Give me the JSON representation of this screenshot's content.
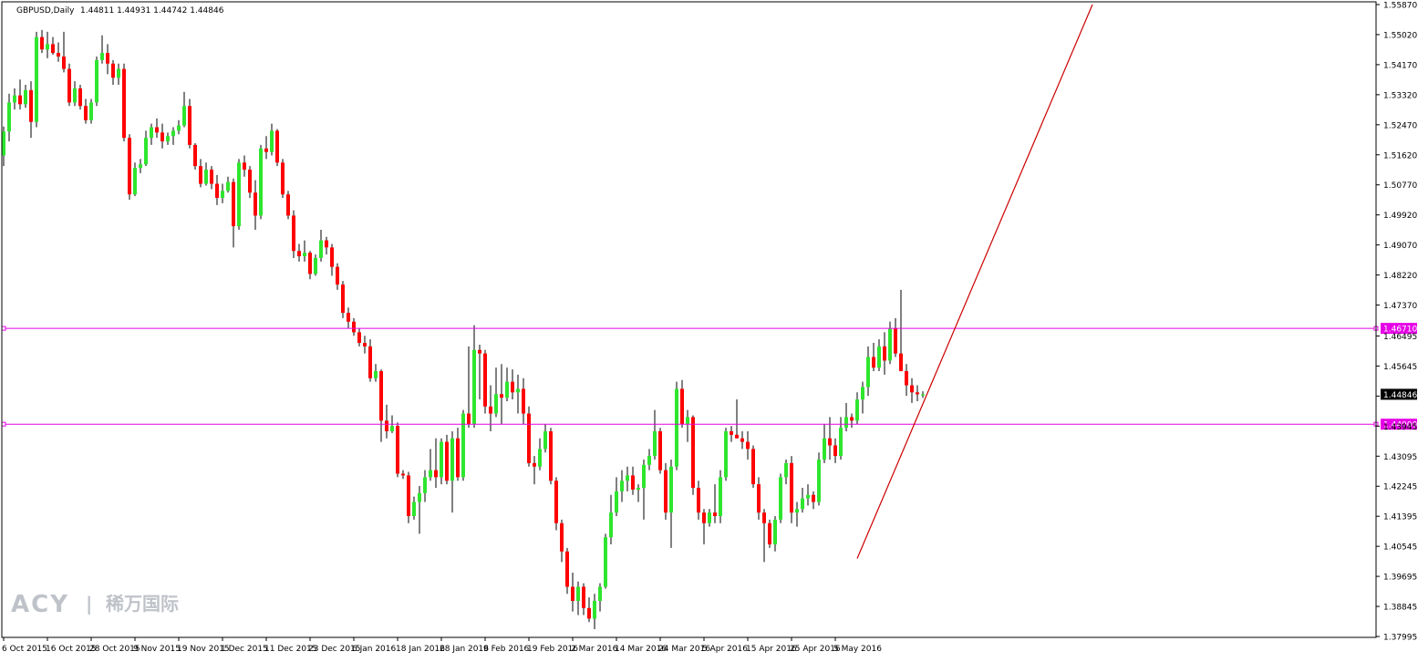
{
  "header": {
    "symbol": "GBPUSD,Daily",
    "ohlc": "1.44811 1.44931 1.44742 1.44846"
  },
  "colors": {
    "bull": "#2ee62e",
    "bear": "#ff0000",
    "wick": "#000000",
    "hline": "#e600e6",
    "trendline": "#cc0000",
    "price_label_bg": "#000000"
  },
  "watermark": {
    "brand": "ACY",
    "separator": "|",
    "cn": "稀万国际"
  },
  "chart_data": {
    "type": "candlestick",
    "title": "GBPUSD,Daily",
    "ylim": [
      1.37995,
      1.5587
    ],
    "y_ticks": [
      "1.55870",
      "1.55020",
      "1.54170",
      "1.53320",
      "1.52470",
      "1.51620",
      "1.50770",
      "1.49920",
      "1.49070",
      "1.48220",
      "1.47370",
      "1.46495",
      "1.45645",
      "1.44795",
      "1.43945",
      "1.43095",
      "1.42245",
      "1.41395",
      "1.40545",
      "1.39695",
      "1.38845",
      "1.37995"
    ],
    "x_labels": [
      "6 Oct 2015",
      "16 Oct 2015",
      "28 Oct 2015",
      "9 Nov 2015",
      "19 Nov 2015",
      "1 Dec 2015",
      "11 Dec 2015",
      "23 Dec 2015",
      "6 Jan 2016",
      "18 Jan 2016",
      "28 Jan 2016",
      "9 Feb 2016",
      "19 Feb 2016",
      "2 Mar 2016",
      "14 Mar 2016",
      "24 Mar 2016",
      "5 Apr 2016",
      "15 Apr 2016",
      "25 Apr 2016",
      "5 May 2016"
    ],
    "horizontal_lines": [
      {
        "price": 1.4671,
        "label": "1.46710"
      },
      {
        "price": 1.44,
        "label": "1.44000"
      }
    ],
    "current_price": {
      "price": 1.44846,
      "label": "1.44846"
    },
    "trendline": {
      "from": [
        156,
        1.402
      ],
      "to": [
        199,
        1.5587
      ]
    },
    "candles": [
      [
        1.516,
        1.5242,
        1.513,
        1.5228
      ],
      [
        1.5228,
        1.5335,
        1.52,
        1.531
      ],
      [
        1.531,
        1.535,
        1.529,
        1.533
      ],
      [
        1.533,
        1.5375,
        1.529,
        1.5305
      ],
      [
        1.5305,
        1.536,
        1.5295,
        1.5345
      ],
      [
        1.5345,
        1.537,
        1.521,
        1.5255
      ],
      [
        1.5255,
        1.551,
        1.524,
        1.5495
      ],
      [
        1.5495,
        1.5515,
        1.545,
        1.546
      ],
      [
        1.546,
        1.551,
        1.5435,
        1.5475
      ],
      [
        1.5475,
        1.5495,
        1.5445,
        1.545
      ],
      [
        1.545,
        1.548,
        1.5425,
        1.544
      ],
      [
        1.544,
        1.551,
        1.5395,
        1.5405
      ],
      [
        1.5405,
        1.542,
        1.53,
        1.531
      ],
      [
        1.531,
        1.537,
        1.53,
        1.535
      ],
      [
        1.535,
        1.536,
        1.529,
        1.53
      ],
      [
        1.53,
        1.532,
        1.525,
        1.526
      ],
      [
        1.526,
        1.532,
        1.525,
        1.531
      ],
      [
        1.531,
        1.544,
        1.53,
        1.543
      ],
      [
        1.543,
        1.55,
        1.542,
        1.545
      ],
      [
        1.545,
        1.5475,
        1.539,
        1.542
      ],
      [
        1.542,
        1.543,
        1.536,
        1.538
      ],
      [
        1.538,
        1.542,
        1.536,
        1.5405
      ],
      [
        1.5405,
        1.542,
        1.52,
        1.521
      ],
      [
        1.521,
        1.522,
        1.5035,
        1.505
      ],
      [
        1.505,
        1.514,
        1.5045,
        1.5125
      ],
      [
        1.5125,
        1.515,
        1.511,
        1.5135
      ],
      [
        1.5135,
        1.523,
        1.513,
        1.521
      ],
      [
        1.521,
        1.525,
        1.519,
        1.524
      ],
      [
        1.524,
        1.5265,
        1.521,
        1.5225
      ],
      [
        1.5225,
        1.525,
        1.518,
        1.52
      ],
      [
        1.52,
        1.5225,
        1.519,
        1.5215
      ],
      [
        1.5215,
        1.524,
        1.519,
        1.523
      ],
      [
        1.523,
        1.526,
        1.522,
        1.5245
      ],
      [
        1.5245,
        1.534,
        1.524,
        1.53
      ],
      [
        1.53,
        1.532,
        1.518,
        1.519
      ],
      [
        1.519,
        1.5195,
        1.512,
        1.513
      ],
      [
        1.513,
        1.515,
        1.507,
        1.508
      ],
      [
        1.508,
        1.514,
        1.5075,
        1.512
      ],
      [
        1.512,
        1.513,
        1.5065,
        1.508
      ],
      [
        1.508,
        1.5105,
        1.502,
        1.504
      ],
      [
        1.504,
        1.508,
        1.5025,
        1.506
      ],
      [
        1.506,
        1.51,
        1.5055,
        1.5085
      ],
      [
        1.5085,
        1.5095,
        1.49,
        1.496
      ],
      [
        1.496,
        1.515,
        1.495,
        1.514
      ],
      [
        1.514,
        1.516,
        1.51,
        1.512
      ],
      [
        1.512,
        1.513,
        1.504,
        1.5055
      ],
      [
        1.5055,
        1.509,
        1.495,
        1.499
      ],
      [
        1.499,
        1.519,
        1.498,
        1.518
      ],
      [
        1.518,
        1.5215,
        1.515,
        1.517
      ],
      [
        1.517,
        1.525,
        1.516,
        1.523
      ],
      [
        1.523,
        1.5235,
        1.513,
        1.514
      ],
      [
        1.514,
        1.515,
        1.504,
        1.505
      ],
      [
        1.505,
        1.506,
        1.498,
        1.499
      ],
      [
        1.499,
        1.5005,
        1.487,
        1.489
      ],
      [
        1.489,
        1.491,
        1.486,
        1.4875
      ],
      [
        1.4875,
        1.492,
        1.486,
        1.4885
      ],
      [
        1.4885,
        1.489,
        1.481,
        1.4825
      ],
      [
        1.4825,
        1.488,
        1.482,
        1.487
      ],
      [
        1.487,
        1.495,
        1.486,
        1.492
      ],
      [
        1.492,
        1.493,
        1.488,
        1.49
      ],
      [
        1.49,
        1.491,
        1.482,
        1.4845
      ],
      [
        1.4845,
        1.4855,
        1.478,
        1.4795
      ],
      [
        1.4795,
        1.4805,
        1.47,
        1.4715
      ],
      [
        1.4715,
        1.473,
        1.467,
        1.469
      ],
      [
        1.469,
        1.47,
        1.465,
        1.466
      ],
      [
        1.466,
        1.467,
        1.462,
        1.463
      ],
      [
        1.463,
        1.465,
        1.46,
        1.462
      ],
      [
        1.462,
        1.464,
        1.452,
        1.453
      ],
      [
        1.453,
        1.457,
        1.452,
        1.455
      ],
      [
        1.455,
        1.4555,
        1.435,
        1.441
      ],
      [
        1.441,
        1.4455,
        1.436,
        1.438
      ],
      [
        1.438,
        1.4425,
        1.4375,
        1.4395
      ],
      [
        1.4395,
        1.4405,
        1.425,
        1.426
      ],
      [
        1.426,
        1.427,
        1.4245,
        1.4255
      ],
      [
        1.4255,
        1.4265,
        1.412,
        1.414
      ],
      [
        1.414,
        1.4195,
        1.413,
        1.418
      ],
      [
        1.418,
        1.4225,
        1.409,
        1.4205
      ],
      [
        1.4205,
        1.427,
        1.418,
        1.425
      ],
      [
        1.425,
        1.433,
        1.424,
        1.427
      ],
      [
        1.427,
        1.436,
        1.422,
        1.425
      ],
      [
        1.425,
        1.436,
        1.423,
        1.435
      ],
      [
        1.435,
        1.437,
        1.423,
        1.424
      ],
      [
        1.424,
        1.438,
        1.415,
        1.436
      ],
      [
        1.436,
        1.439,
        1.424,
        1.425
      ],
      [
        1.425,
        1.444,
        1.424,
        1.443
      ],
      [
        1.443,
        1.462,
        1.439,
        1.44
      ],
      [
        1.44,
        1.468,
        1.439,
        1.461
      ],
      [
        1.461,
        1.4625,
        1.447,
        1.46
      ],
      [
        1.46,
        1.461,
        1.443,
        1.445
      ],
      [
        1.445,
        1.451,
        1.438,
        1.443
      ],
      [
        1.443,
        1.456,
        1.442,
        1.4485
      ],
      [
        1.4485,
        1.457,
        1.44,
        1.4475
      ],
      [
        1.4475,
        1.456,
        1.4465,
        1.452
      ],
      [
        1.452,
        1.4555,
        1.447,
        1.449
      ],
      [
        1.449,
        1.454,
        1.443,
        1.45
      ],
      [
        1.45,
        1.453,
        1.44,
        1.443
      ],
      [
        1.443,
        1.445,
        1.428,
        1.429
      ],
      [
        1.429,
        1.431,
        1.423,
        1.428
      ],
      [
        1.428,
        1.436,
        1.427,
        1.433
      ],
      [
        1.433,
        1.44,
        1.432,
        1.438
      ],
      [
        1.438,
        1.439,
        1.423,
        1.424
      ],
      [
        1.424,
        1.425,
        1.41,
        1.412
      ],
      [
        1.412,
        1.413,
        1.401,
        1.404
      ],
      [
        1.404,
        1.405,
        1.392,
        1.394
      ],
      [
        1.394,
        1.398,
        1.387,
        1.39
      ],
      [
        1.39,
        1.3955,
        1.386,
        1.394
      ],
      [
        1.394,
        1.395,
        1.386,
        1.388
      ],
      [
        1.388,
        1.391,
        1.384,
        1.385
      ],
      [
        1.385,
        1.392,
        1.382,
        1.39
      ],
      [
        1.39,
        1.395,
        1.387,
        1.394
      ],
      [
        1.394,
        1.409,
        1.3935,
        1.408
      ],
      [
        1.408,
        1.42,
        1.406,
        1.415
      ],
      [
        1.415,
        1.425,
        1.414,
        1.421
      ],
      [
        1.421,
        1.427,
        1.418,
        1.424
      ],
      [
        1.424,
        1.428,
        1.421,
        1.4255
      ],
      [
        1.4255,
        1.428,
        1.42,
        1.4215
      ],
      [
        1.4215,
        1.423,
        1.418,
        1.422
      ],
      [
        1.422,
        1.43,
        1.413,
        1.4285
      ],
      [
        1.4285,
        1.433,
        1.427,
        1.431
      ],
      [
        1.431,
        1.444,
        1.43,
        1.438
      ],
      [
        1.438,
        1.439,
        1.426,
        1.427
      ],
      [
        1.427,
        1.429,
        1.413,
        1.415
      ],
      [
        1.415,
        1.43,
        1.405,
        1.428
      ],
      [
        1.428,
        1.452,
        1.427,
        1.45
      ],
      [
        1.45,
        1.4525,
        1.439,
        1.44
      ],
      [
        1.44,
        1.444,
        1.435,
        1.442
      ],
      [
        1.442,
        1.4425,
        1.42,
        1.422
      ],
      [
        1.422,
        1.424,
        1.413,
        1.415
      ],
      [
        1.415,
        1.416,
        1.406,
        1.412
      ],
      [
        1.412,
        1.416,
        1.411,
        1.415
      ],
      [
        1.415,
        1.423,
        1.412,
        1.414
      ],
      [
        1.414,
        1.427,
        1.412,
        1.425
      ],
      [
        1.425,
        1.439,
        1.424,
        1.438
      ],
      [
        1.438,
        1.4395,
        1.435,
        1.437
      ],
      [
        1.437,
        1.447,
        1.436,
        1.436
      ],
      [
        1.436,
        1.438,
        1.433,
        1.435
      ],
      [
        1.435,
        1.438,
        1.43,
        1.433
      ],
      [
        1.433,
        1.434,
        1.422,
        1.423
      ],
      [
        1.423,
        1.425,
        1.413,
        1.415
      ],
      [
        1.415,
        1.416,
        1.401,
        1.412
      ],
      [
        1.412,
        1.413,
        1.405,
        1.406
      ],
      [
        1.406,
        1.414,
        1.404,
        1.413
      ],
      [
        1.413,
        1.426,
        1.412,
        1.425
      ],
      [
        1.425,
        1.43,
        1.423,
        1.429
      ],
      [
        1.429,
        1.431,
        1.412,
        1.415
      ],
      [
        1.415,
        1.418,
        1.411,
        1.416
      ],
      [
        1.416,
        1.422,
        1.415,
        1.419
      ],
      [
        1.419,
        1.423,
        1.417,
        1.42
      ],
      [
        1.42,
        1.421,
        1.416,
        1.418
      ],
      [
        1.418,
        1.432,
        1.417,
        1.43
      ],
      [
        1.43,
        1.44,
        1.429,
        1.436
      ],
      [
        1.436,
        1.442,
        1.43,
        1.434
      ],
      [
        1.434,
        1.436,
        1.429,
        1.431
      ],
      [
        1.431,
        1.442,
        1.43,
        1.439
      ],
      [
        1.439,
        1.446,
        1.438,
        1.442
      ],
      [
        1.442,
        1.443,
        1.439,
        1.441
      ],
      [
        1.441,
        1.449,
        1.44,
        1.447
      ],
      [
        1.447,
        1.452,
        1.443,
        1.4505
      ],
      [
        1.4505,
        1.462,
        1.448,
        1.459
      ],
      [
        1.459,
        1.463,
        1.455,
        1.456
      ],
      [
        1.456,
        1.464,
        1.455,
        1.462
      ],
      [
        1.462,
        1.466,
        1.454,
        1.458
      ],
      [
        1.458,
        1.469,
        1.457,
        1.467
      ],
      [
        1.467,
        1.47,
        1.459,
        1.46
      ],
      [
        1.46,
        1.478,
        1.455,
        1.455
      ],
      [
        1.455,
        1.457,
        1.448,
        1.451
      ],
      [
        1.451,
        1.453,
        1.446,
        1.449
      ],
      [
        1.449,
        1.451,
        1.4465,
        1.44846
      ],
      [
        1.44811,
        1.44931,
        1.44742,
        1.44846
      ]
    ]
  }
}
